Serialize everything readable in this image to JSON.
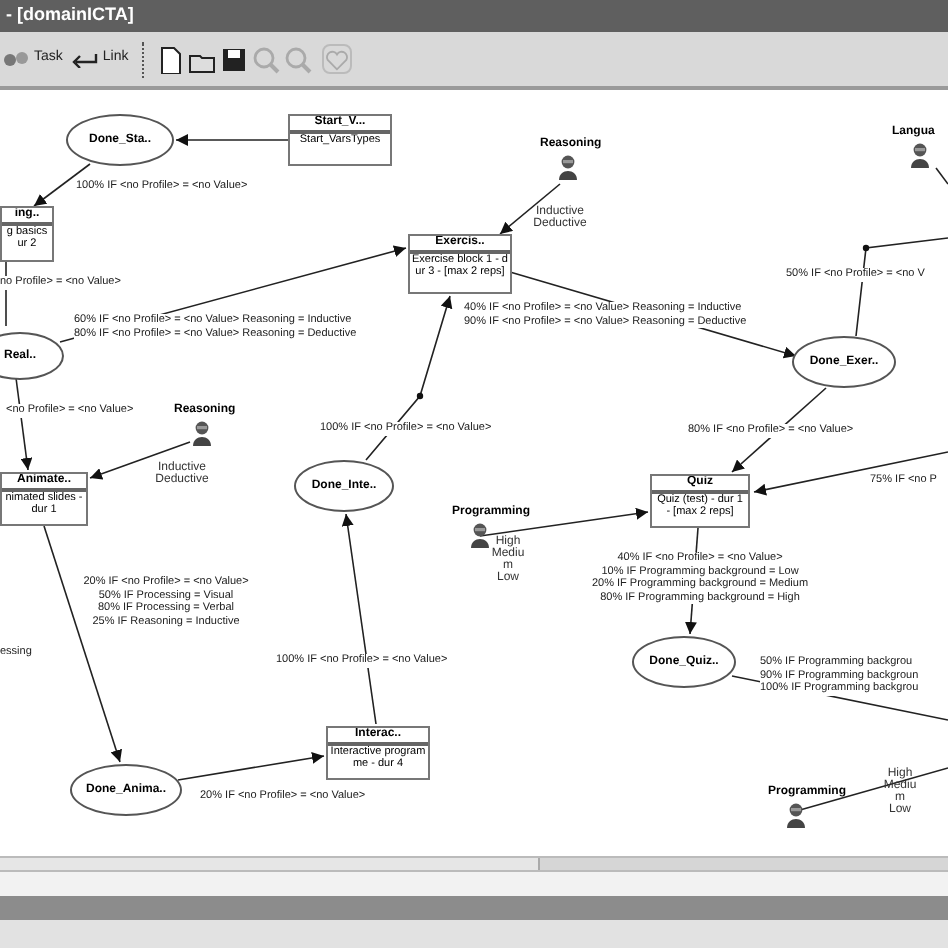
{
  "window": {
    "title": "- [domainICTA]"
  },
  "toolbar": {
    "buttons": [
      {
        "label": "Task",
        "kind": "task"
      },
      {
        "label": "Link",
        "kind": "link"
      }
    ],
    "tools": [
      {
        "kind": "new",
        "disabled": false
      },
      {
        "kind": "open",
        "disabled": false
      },
      {
        "kind": "save",
        "disabled": false
      },
      {
        "kind": "zoom-in",
        "disabled": true
      },
      {
        "kind": "zoom-out",
        "disabled": true
      },
      {
        "kind": "heart",
        "disabled": true
      }
    ]
  },
  "diagram": {
    "states": [
      {
        "label": "Done_Sta.."
      },
      {
        "label": "Real.."
      },
      {
        "label": "Done_Exer.."
      },
      {
        "label": "Done_Inte.."
      },
      {
        "label": "Done_Quiz.."
      },
      {
        "label": "Done_Anima.."
      }
    ],
    "tasks": [
      {
        "title": "Start_V...",
        "body": "Start_VarsTypes"
      },
      {
        "title": "ing..",
        "body": "g basics ur 2"
      },
      {
        "title": "Exercis..",
        "body": "Exercise block 1 - dur 3 - [max 2 reps]"
      },
      {
        "title": "Animate..",
        "body": "nimated slides - dur 1"
      },
      {
        "title": "Quiz",
        "body": "Quiz (test) - dur 1 - [max 2 reps]"
      },
      {
        "title": "Interac..",
        "body": "Interactive programme - dur 4"
      }
    ],
    "profiles": [
      {
        "name": "Reasoning",
        "values": [
          "Inductive",
          "Deductive"
        ]
      },
      {
        "name": "Langua"
      },
      {
        "name": "Reasoning",
        "values": [
          "Inductive",
          "Deductive"
        ]
      },
      {
        "name": "Programming",
        "values": [
          "High",
          "Mediu",
          "m",
          "Low"
        ]
      },
      {
        "name": "Programming",
        "values": [
          "High",
          "Mediu",
          "m",
          "Low"
        ]
      }
    ],
    "conditions": [
      {
        "lines": [
          "100% IF <no Profile> = <no Value>"
        ]
      },
      {
        "lines": [
          "no Profile> = <no Value>"
        ]
      },
      {
        "lines": [
          "40% IF <no Profile> = <no Value> Reasoning = Inductive",
          "90% IF <no Profile> = <no Value> Reasoning = Deductive"
        ]
      },
      {
        "lines": [
          "50% IF <no Profile> = <no V"
        ]
      },
      {
        "lines": [
          "60% IF <no Profile> = <no Value> Reasoning = Inductive",
          "80% IF <no Profile> = <no Value> Reasoning = Deductive"
        ]
      },
      {
        "lines": [
          "<no Profile> = <no Value>"
        ]
      },
      {
        "lines": [
          "100% IF <no Profile> = <no Value>"
        ]
      },
      {
        "lines": [
          "80% IF <no Profile> = <no Value>"
        ]
      },
      {
        "lines": [
          "75% IF <no P"
        ]
      },
      {
        "lines": [
          "40% IF <no Profile> = <no Value>",
          "10% IF Programming background = Low",
          "20% IF Programming background = Medium",
          "80% IF Programming background = High"
        ]
      },
      {
        "lines": [
          "20% IF <no Profile> = <no Value>",
          "50% IF Processing = Visual",
          "80% IF Processing = Verbal",
          "25% IF Reasoning = Inductive"
        ]
      },
      {
        "lines": [
          "essing"
        ]
      },
      {
        "lines": [
          "100% IF <no Profile> = <no Value>"
        ]
      },
      {
        "lines": [
          "50% IF Programming backgrou",
          "90% IF Programming backgroun",
          "100% IF Programming backgrou"
        ]
      },
      {
        "lines": [
          "20% IF <no Profile> = <no Value>"
        ]
      }
    ]
  }
}
